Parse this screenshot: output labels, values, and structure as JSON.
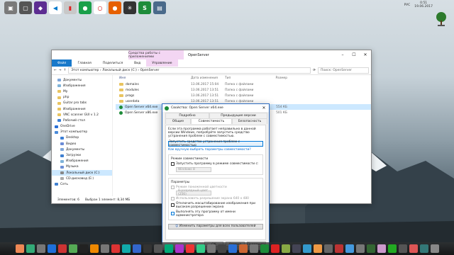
{
  "colors": {
    "accent": "#1979ca",
    "context_tab": "#f3d6f3",
    "selected": "#cce8ff",
    "link": "#0066cc"
  },
  "tray": {
    "lang": "РУС",
    "time": "0:51",
    "date": "19.06.2017"
  },
  "explorer": {
    "context_tab": "Средства работы с приложениями",
    "title": "OpenServer",
    "ribbon_tabs": [
      "Файл",
      "Главная",
      "Поделиться",
      "Вид",
      "Управление"
    ],
    "address": [
      "Этот компьютер",
      "Локальный диск (C:)",
      "OpenServer"
    ],
    "search_placeholder": "Поиск: OpenServer",
    "sidebar": [
      {
        "label": "Документы",
        "icon": "documents-icon"
      },
      {
        "label": "Изображения",
        "icon": "pictures-icon"
      },
      {
        "label": "My",
        "icon": "folder-icon"
      },
      {
        "label": "php",
        "icon": "folder-icon"
      },
      {
        "label": "Guitar pro tabs",
        "icon": "folder-icon"
      },
      {
        "label": "Изображения",
        "icon": "folder-icon"
      },
      {
        "label": "VNC scanner GUI v 1.2",
        "icon": "folder-icon"
      },
      {
        "label": "Рабочий стол",
        "icon": "desktop-icon"
      },
      {
        "label": "OneDrive",
        "icon": "onedrive-icon"
      },
      {
        "label": "Этот компьютер",
        "icon": "computer-icon"
      },
      {
        "label": "Desktop",
        "icon": "desktop-icon"
      },
      {
        "label": "Видео",
        "icon": "video-icon"
      },
      {
        "label": "Документы",
        "icon": "documents-icon"
      },
      {
        "label": "Загрузки",
        "icon": "downloads-icon"
      },
      {
        "label": "Изображения",
        "icon": "pictures-icon"
      },
      {
        "label": "Музыка",
        "icon": "music-icon"
      },
      {
        "label": "Локальный диск (C:)",
        "icon": "drive-icon",
        "selected": true
      },
      {
        "label": "CD-дисковод (E:)",
        "icon": "cd-icon"
      },
      {
        "label": "Сеть",
        "icon": "network-icon"
      }
    ],
    "columns": [
      "Имя",
      "Дата изменения",
      "Тип",
      "Размер"
    ],
    "files": [
      {
        "name": "domains",
        "date": "13.06.2017 15:04",
        "type": "Папка с файлами",
        "size": "",
        "icon": "folder"
      },
      {
        "name": "modules",
        "date": "13.06.2017 13:51",
        "type": "Папка с файлами",
        "size": "",
        "icon": "folder"
      },
      {
        "name": "progs",
        "date": "13.06.2017 13:51",
        "type": "Папка с файлами",
        "size": "",
        "icon": "folder"
      },
      {
        "name": "userdata",
        "date": "13.06.2017 13:51",
        "type": "Папка с файлами",
        "size": "",
        "icon": "folder"
      },
      {
        "name": "Open Server x64.exe",
        "date": "",
        "type": "",
        "size": "554 КБ",
        "icon": "exe"
      },
      {
        "name": "Open Server x86.exe",
        "date": "",
        "type": "",
        "size": "501 КБ",
        "icon": "exe"
      }
    ],
    "status": [
      "Элементов: 6",
      "Выбран 1 элемент: 8,34 МБ"
    ]
  },
  "dialog": {
    "title": "Свойства: Open Server x64.exe",
    "tabs_top": [
      "Подробно",
      "Предыдущие версии"
    ],
    "tabs_bottom": [
      "Общие",
      "Совместимость",
      "Безопасность"
    ],
    "intro": "Если эта программа работает неправильно в данной версии Windows, попробуйте запустить средство устранения проблем с совместимостью.",
    "run_troubleshooter": "Запустить средство устранения проблем с совместимостью",
    "manual_link": "Как вручную выбрать параметры совместимости?",
    "compat_group": "Режим совместимости",
    "compat_check": "Запустить программу в режиме совместимости с:",
    "compat_os": "Windows 8",
    "params_group": "Параметры",
    "reduced_color": "Режим пониженной цветности",
    "color_value": "8-разрядный цвет (256)",
    "res_640": "Использовать разрешение экрана 640 x 480",
    "dpi_scaling": "Отключить масштабирование изображения при высоком разрешении экрана",
    "run_admin": "Выполнять эту программу от имени администратора",
    "change_all": "Изменить параметры для всех пользователей",
    "ok": "ОК",
    "cancel": "Отмена",
    "apply": "Применить"
  },
  "top_dock": [
    "app-1-icon",
    "app-2-icon",
    "visual-studio-icon",
    "vscode-icon",
    "app-5-icon",
    "app-6-icon",
    "opera-icon",
    "firefox-icon",
    "app-9-icon",
    "openserver-icon",
    "app-11-icon"
  ],
  "taskbar_apps": 40
}
